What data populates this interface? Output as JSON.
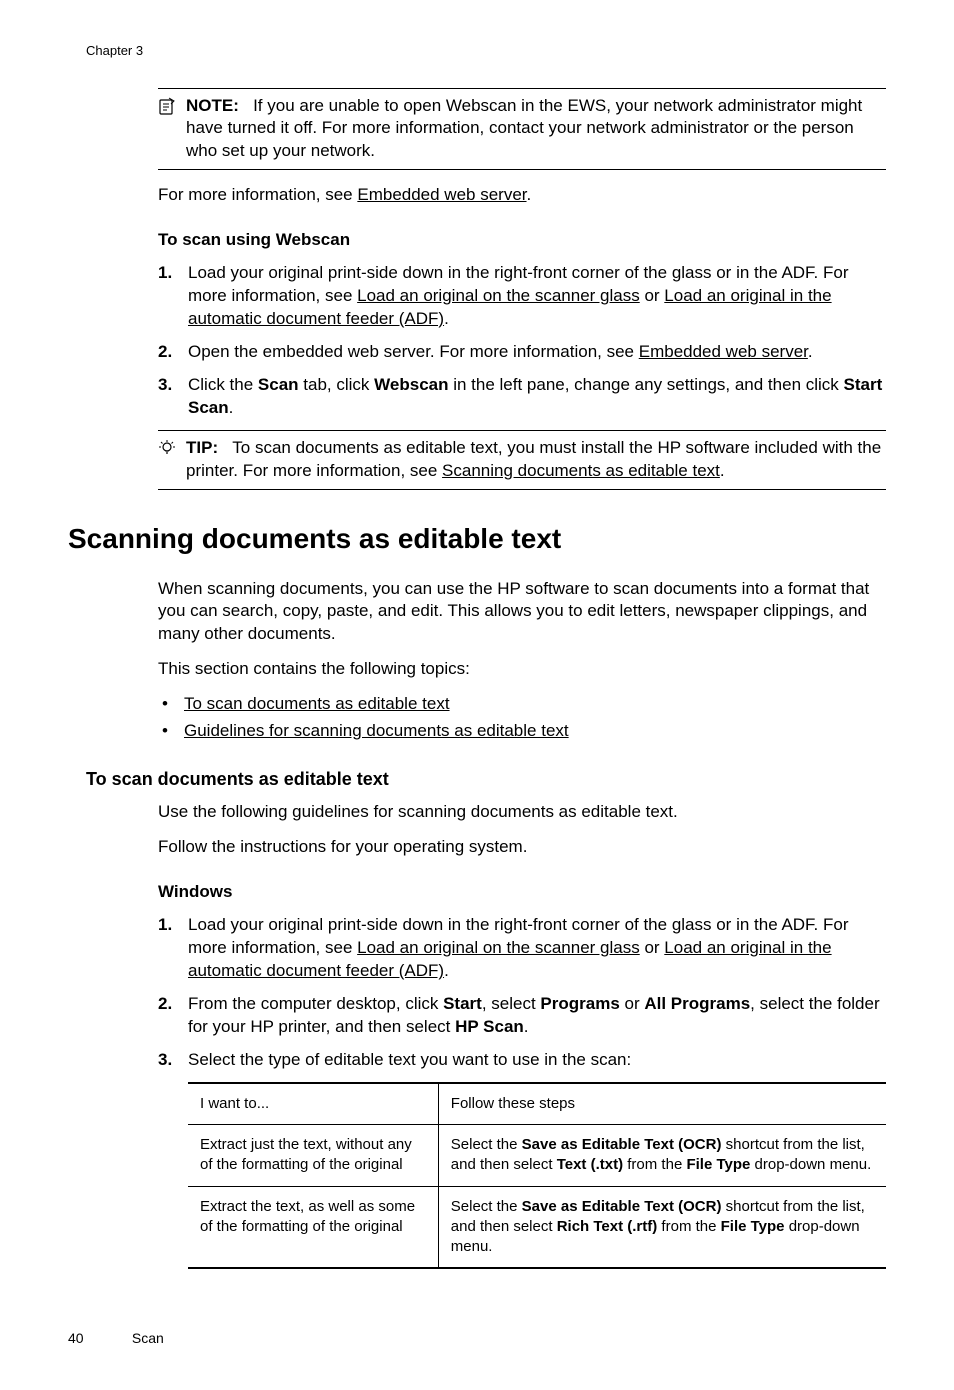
{
  "chapter_header": "Chapter 3",
  "note_box": {
    "label": "NOTE:",
    "text": "If you are unable to open Webscan in the EWS, your network administrator might have turned it off. For more information, contact your network administrator or the person who set up your network."
  },
  "more_info_prefix": "For more information, see ",
  "more_info_link": "Embedded web server",
  "period": ".",
  "webscan_heading": "To scan using Webscan",
  "webscan_steps": {
    "s1_a": "Load your original print-side down in the right-front corner of the glass or in the ADF. For more information, see ",
    "s1_l1": "Load an original on the scanner glass",
    "s1_mid": " or ",
    "s1_l2": "Load an original in the automatic document feeder (ADF)",
    "s2_a": "Open the embedded web server. For more information, see ",
    "s2_l1": "Embedded web server",
    "s3_a": "Click the ",
    "s3_b1": "Scan",
    "s3_b": " tab, click ",
    "s3_b2": "Webscan",
    "s3_c": " in the left pane, change any settings, and then click ",
    "s3_b3": "Start Scan"
  },
  "tip_box": {
    "label": "TIP:",
    "text_a": "To scan documents as editable text, you must install the HP software included with the printer. For more information, see ",
    "link": "Scanning documents as editable text"
  },
  "main_heading": "Scanning documents as editable text",
  "intro_para": "When scanning documents, you can use the HP software to scan documents into a format that you can search, copy, paste, and edit. This allows you to edit letters, newspaper clippings, and many other documents.",
  "topics_intro": "This section contains the following topics:",
  "topics": {
    "t1": "To scan documents as editable text",
    "t2": "Guidelines for scanning documents as editable text"
  },
  "h3_sub": "To scan documents as editable text",
  "guidelines_para": "Use the following guidelines for scanning documents as editable text.",
  "follow_para": "Follow the instructions for your operating system.",
  "windows_heading": "Windows",
  "win_steps": {
    "s1_a": "Load your original print-side down in the right-front corner of the glass or in the ADF. For more information, see ",
    "s1_l1": "Load an original on the scanner glass",
    "s1_mid": " or ",
    "s1_l2": "Load an original in the automatic document feeder (ADF)",
    "s2_a": "From the computer desktop, click ",
    "s2_b1": "Start",
    "s2_b": ", select ",
    "s2_b2": "Programs",
    "s2_c": " or ",
    "s2_b3": "All Programs",
    "s2_d": ", select the folder for your HP printer, and then select ",
    "s2_b4": "HP Scan",
    "s3": "Select the type of editable text you want to use in the scan:"
  },
  "table": {
    "h1": "I want to...",
    "h2": "Follow these steps",
    "r1c1": "Extract just the text, without any of the formatting of the original",
    "r1c2_a": "Select the ",
    "r1c2_b1": "Save as Editable Text (OCR)",
    "r1c2_c": " shortcut from the list, and then select ",
    "r1c2_b2": "Text (.txt)",
    "r1c2_d": " from the ",
    "r1c2_b3": "File Type",
    "r1c2_e": " drop-down menu.",
    "r2c1": "Extract the text, as well as some of the formatting of the original",
    "r2c2_a": "Select the ",
    "r2c2_b1": "Save as Editable Text (OCR)",
    "r2c2_c": " shortcut from the list, and then select ",
    "r2c2_b2": "Rich Text (.rtf)",
    "r2c2_d": " from the ",
    "r2c2_b3": "File Type",
    "r2c2_e": " drop-down menu."
  },
  "footer": {
    "page": "40",
    "section": "Scan"
  }
}
